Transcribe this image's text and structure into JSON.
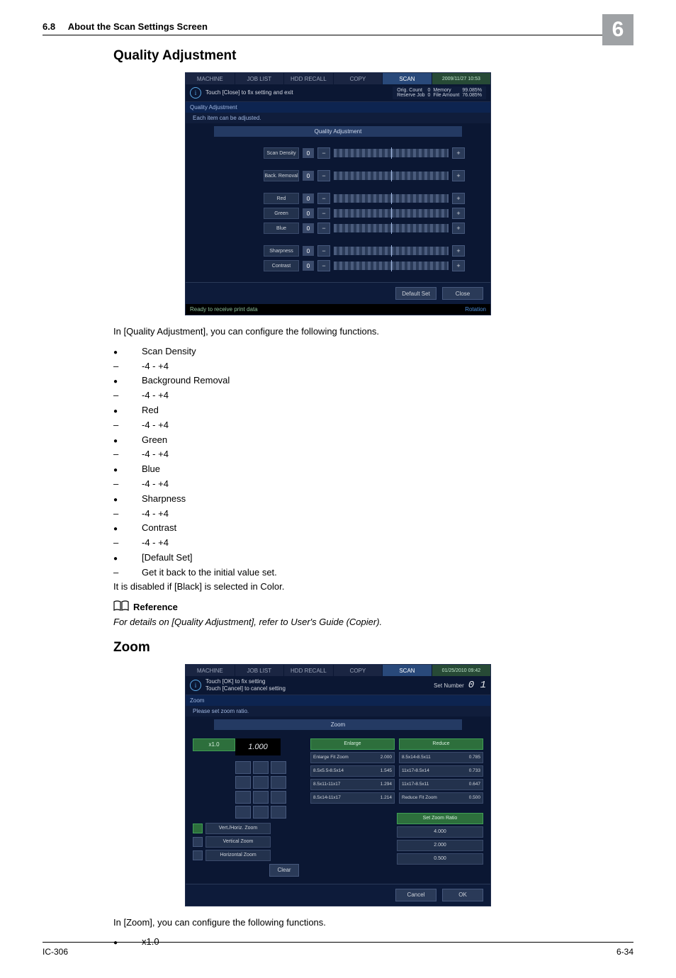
{
  "header": {
    "section_number": "6.8",
    "section_title": "About the Scan Settings Screen"
  },
  "chapter": "6",
  "qa": {
    "title": "Quality Adjustment",
    "intro": "In [Quality Adjustment], you can configure the following functions.",
    "items": [
      {
        "type": "bullet",
        "text": "Scan Density"
      },
      {
        "type": "dash",
        "text": "-4 - +4"
      },
      {
        "type": "bullet",
        "text": "Background Removal"
      },
      {
        "type": "dash",
        "text": "-4 - +4"
      },
      {
        "type": "bullet",
        "text": "Red"
      },
      {
        "type": "dash",
        "text": "-4 - +4"
      },
      {
        "type": "bullet",
        "text": "Green"
      },
      {
        "type": "dash",
        "text": "-4 - +4"
      },
      {
        "type": "bullet",
        "text": "Blue"
      },
      {
        "type": "dash",
        "text": "-4 - +4"
      },
      {
        "type": "bullet",
        "text": "Sharpness"
      },
      {
        "type": "dash",
        "text": "-4 - +4"
      },
      {
        "type": "bullet",
        "text": "Contrast"
      },
      {
        "type": "dash",
        "text": "-4 - +4"
      },
      {
        "type": "bullet",
        "text": "[Default Set]"
      },
      {
        "type": "dash",
        "text": "Get it back to the initial value set."
      }
    ],
    "note": "It is disabled if [Black] is selected in Color.",
    "reference_label": "Reference",
    "reference_text": "For details on [Quality Adjustment], refer to User's Guide (Copier).",
    "panel": {
      "tabs": {
        "machine": "MACHINE",
        "joblist": "JOB LIST",
        "hdd": "HDD RECALL",
        "copy": "COPY",
        "scan": "SCAN"
      },
      "clock": "2009/11/27 10:53",
      "info": "Touch [Close] to fix setting and exit",
      "stats": {
        "orig_count_label": "Orig. Count",
        "orig_count": "0",
        "memory_label": "Memory",
        "memory": "99.085%",
        "reserve_label": "Reserve Job",
        "reserve": "0",
        "file_label": "File Amount",
        "file": "76.085%"
      },
      "section": "Quality Adjustment",
      "sub": "Each item can be adjusted.",
      "mid": "Quality Adjustment",
      "sliders": {
        "scan_density": "Scan Density",
        "back_removal": "Back. Removal",
        "red": "Red",
        "green": "Green",
        "blue": "Blue",
        "sharpness": "Sharpness",
        "contrast": "Contrast",
        "zero": "0",
        "minus": "−",
        "plus": "+"
      },
      "buttons": {
        "default": "Default Set",
        "close": "Close"
      },
      "status": "Ready to receive print data",
      "rotation": "Rotation"
    }
  },
  "zoom": {
    "title": "Zoom",
    "intro": "In [Zoom], you can configure the following functions.",
    "items": [
      {
        "type": "bullet",
        "text": "x1.0"
      }
    ],
    "panel": {
      "tabs": {
        "machine": "MACHINE",
        "joblist": "JOB LIST",
        "hdd": "HDD RECALL",
        "copy": "COPY",
        "scan": "SCAN"
      },
      "clock": "01/25/2010 09:42",
      "info": "Touch [OK] to fix setting\nTouch [Cancel] to cancel setting",
      "set_number_label": "Set Number",
      "set_number": "0 1",
      "section": "Zoom",
      "sub": "Please set zoom ratio.",
      "mid": "Zoom",
      "x1": "x1.0",
      "display": "1.000",
      "modes": {
        "vhz": "Vert./Horiz. Zoom",
        "vz": "Vertical Zoom",
        "hz": "Horizontal Zoom"
      },
      "clear": "Clear",
      "enlarge_hdr": "Enlarge",
      "reduce_hdr": "Reduce",
      "enlarge": [
        {
          "l": "Enlarge Fit Zoom",
          "r": "2.000"
        },
        {
          "l": "8.5x5.5›8.5x14",
          "r": "1.545"
        },
        {
          "l": "8.5x11›11x17",
          "r": "1.294"
        },
        {
          "l": "8.5x14›11x17",
          "r": "1.214"
        }
      ],
      "reduce": [
        {
          "l": "8.5x14›8.5x11",
          "r": "0.785"
        },
        {
          "l": "11x17›8.5x14",
          "r": "0.733"
        },
        {
          "l": "11x17›8.5x11",
          "r": "0.647"
        },
        {
          "l": "Reduce Fit Zoom",
          "r": "0.500"
        }
      ],
      "set_zoom_hdr": "Set Zoom Ratio",
      "set_zoom": [
        "4.000",
        "2.000",
        "0.500"
      ],
      "buttons": {
        "cancel": "Cancel",
        "ok": "OK"
      }
    }
  },
  "footer": {
    "left": "IC-306",
    "right": "6-34"
  }
}
